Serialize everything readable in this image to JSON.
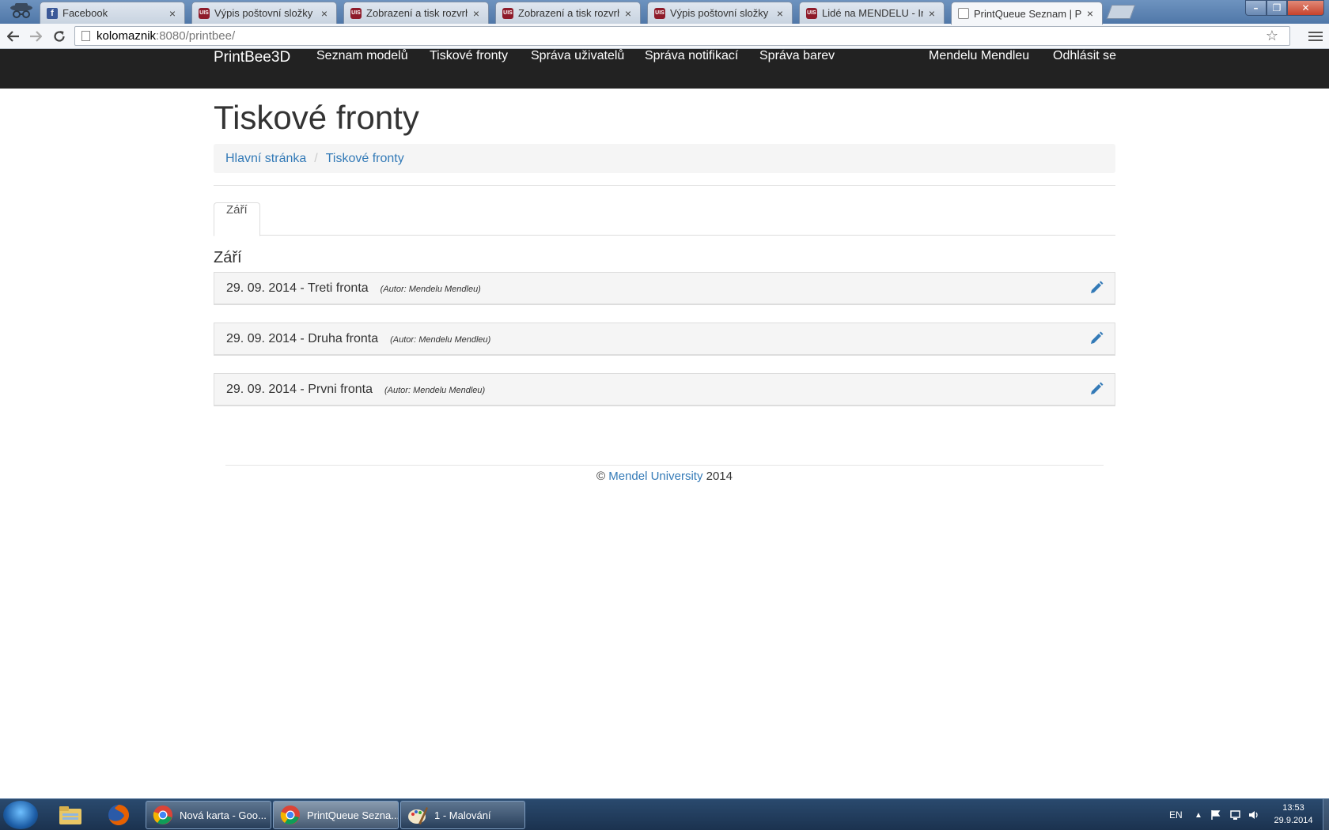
{
  "browser": {
    "tabs": [
      {
        "label": "Facebook",
        "icon": "facebook-icon"
      },
      {
        "label": "Výpis poštovní složky",
        "icon": "uis-icon"
      },
      {
        "label": "Zobrazení a tisk rozvrhů",
        "icon": "uis-icon"
      },
      {
        "label": "Zobrazení a tisk rozvrhů",
        "icon": "uis-icon"
      },
      {
        "label": "Výpis poštovní složky",
        "icon": "uis-icon"
      },
      {
        "label": "Lidé na MENDELU - Ing. P",
        "icon": "uis-icon"
      },
      {
        "label": "PrintQueue Seznam | Print",
        "icon": "page-icon",
        "active": true
      }
    ],
    "address": {
      "host": "kolomaznik",
      "rest": ":8080/printbee/"
    },
    "fav_badge": "UIS",
    "fb_badge": "f"
  },
  "navbar": {
    "brand": "PrintBee3D",
    "items": [
      "Seznam modelů",
      "Tiskové fronty",
      "Správa uživatelů",
      "Správa notifikací",
      "Správa barev"
    ],
    "user": "Mendelu Mendleu",
    "logout": "Odhlásit se"
  },
  "page": {
    "title": "Tiskové fronty",
    "breadcrumb": [
      "Hlavní stránka",
      "Tiskové fronty"
    ],
    "tab": "Září",
    "month_heading": "Září",
    "queues": [
      {
        "title": "29. 09. 2014 - Treti fronta",
        "author": "(Autor: Mendelu Mendleu)"
      },
      {
        "title": "29. 09. 2014 - Druha fronta",
        "author": "(Autor: Mendelu Mendleu)"
      },
      {
        "title": "29. 09. 2014 - Prvni fronta",
        "author": "(Autor: Mendelu Mendleu)"
      }
    ],
    "accent_color": "#337ab7"
  },
  "footer": {
    "copyright": "©",
    "link": "Mendel University",
    "year": "2014"
  },
  "taskbar": {
    "tasks": [
      "Nová karta - Goo...",
      "PrintQueue Sezna...",
      "1 - Malování"
    ],
    "language": "EN",
    "time": "13:53",
    "date": "29.9.2014"
  }
}
